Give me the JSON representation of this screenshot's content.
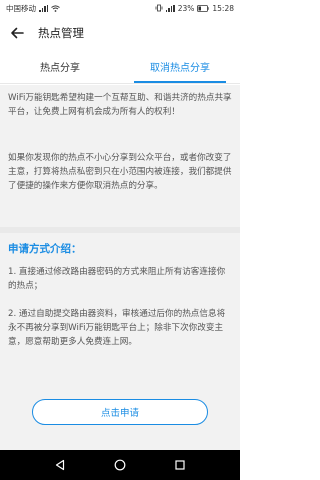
{
  "status_bar": {
    "carrier": "中国移动",
    "battery": "23%",
    "time": "15:28"
  },
  "header": {
    "title": "热点管理"
  },
  "tabs": [
    {
      "label": "热点分享"
    },
    {
      "label": "取消热点分享"
    }
  ],
  "intro": {
    "paragraph1": "WiFi万能钥匙希望构建一个互帮互助、和谐共济的热点共享平台，让免费上网有机会成为所有人的权利！",
    "paragraph2": "如果你发现你的热点不小心分享到公众平台，或者你改变了主意，打算将热点私密到只在小范围内被连接，我们都提供了便捷的操作来方便你取消热点的分享。"
  },
  "apply_section": {
    "title": "申请方式介绍：",
    "step1": "1. 直接通过修改路由器密码的方式来阻止所有访客连接你的热点；",
    "step2": "2. 通过自助提交路由器资料，审核通过后你的热点信息将永不再被分享到WiFi万能钥匙平台上；除非下次你改变主意，愿意帮助更多人免费连上网。"
  },
  "button": {
    "label": "点击申请"
  },
  "colors": {
    "accent": "#1a8ce3",
    "background": "#f2f2f2"
  }
}
